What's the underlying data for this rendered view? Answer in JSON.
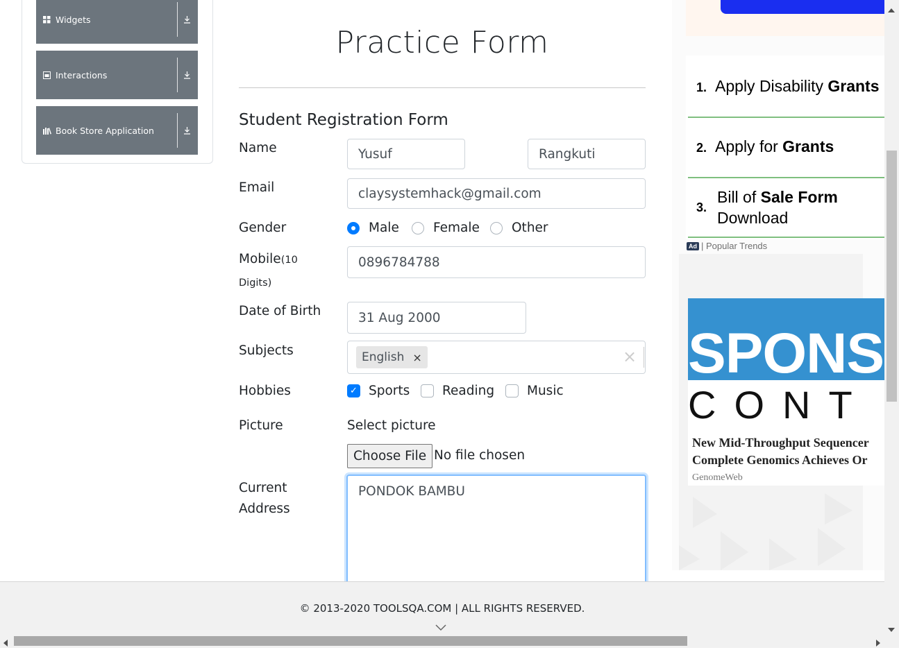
{
  "sidebar": {
    "items": [
      {
        "label": "Widgets",
        "icon": "widgets-icon"
      },
      {
        "label": "Interactions",
        "icon": "interactions-icon"
      },
      {
        "label": "Book Store Application",
        "icon": "book-icon"
      }
    ]
  },
  "page": {
    "title": "Practice Form",
    "subtitle": "Student Registration Form"
  },
  "form": {
    "name": {
      "label": "Name",
      "first": "Yusuf",
      "last": "Rangkuti"
    },
    "email": {
      "label": "Email",
      "value": "claysystemhack@gmail.com"
    },
    "gender": {
      "label": "Gender",
      "options": [
        "Male",
        "Female",
        "Other"
      ],
      "selected": "Male"
    },
    "mobile": {
      "label": "Mobile",
      "label_suffix": "(10",
      "label_suffix2": "Digits)",
      "value": "0896784788"
    },
    "dob": {
      "label": "Date of Birth",
      "value": "31 Aug 2000"
    },
    "subjects": {
      "label": "Subjects",
      "tags": [
        "English"
      ],
      "remove_glyph": "×",
      "clear_glyph": "×"
    },
    "hobbies": {
      "label": "Hobbies",
      "options": [
        "Sports",
        "Reading",
        "Music"
      ],
      "checked": [
        "Sports"
      ]
    },
    "picture": {
      "label": "Picture",
      "prompt": "Select picture",
      "button": "Choose File",
      "status": "No file chosen"
    },
    "address": {
      "label_line1": "Current",
      "label_line2": "Address",
      "value": "PONDOK BAMBU"
    }
  },
  "footer": {
    "text": "© 2013-2020 TOOLSQA.COM | ALL RIGHTS RESERVED."
  },
  "ads": {
    "list": [
      {
        "num": "1.",
        "text": "Apply Disability ",
        "bold": "Grants"
      },
      {
        "num": "2.",
        "text": "Apply for ",
        "bold": "Grants"
      },
      {
        "num": "3.",
        "text": "Bill of ",
        "bold": "Sale Form",
        "text2": "Download"
      }
    ],
    "badge": "Ad",
    "source_label": "| Popular Trends",
    "sponsored_line1": "SPONS",
    "sponsored_line2": "CONT",
    "headline1": "New Mid-Throughput Sequencer",
    "headline2": "Complete Genomics Achieves Or",
    "publisher": "GenomeWeb"
  },
  "colors": {
    "sidebar": "#6c757d",
    "accent": "#007bff",
    "ad_line": "#7fbf7f",
    "sponsored_blue": "#3591d0"
  }
}
